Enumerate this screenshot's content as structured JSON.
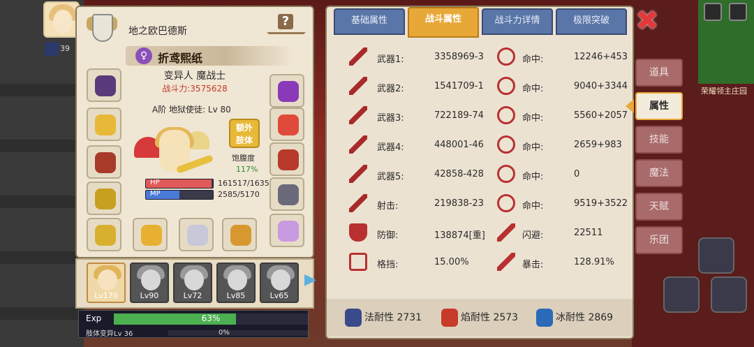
{
  "hero": {
    "realm_name": "地之欧巴德斯",
    "char_name": "折鸢熙纸",
    "class_line": "变异人 魔战士",
    "power_label": "战斗力:3575628",
    "rank_line": "A阶 地狱使徒: Lv 80",
    "extra_limb_btn": "额外\n肢体",
    "satiety_label": "饱腹度",
    "satiety_value": "117%",
    "hp_label": "HP",
    "hp_value": "161517/1635",
    "hp_fill": 0.98,
    "mp_label": "MP",
    "mp_value": "2585/5170",
    "mp_fill": 0.5,
    "hp_color": "#e05a5a",
    "mp_color": "#4a7ad8"
  },
  "top_left": {
    "level_badge": "39"
  },
  "party": [
    {
      "lv": "Lv170",
      "active": true
    },
    {
      "lv": "Lv90",
      "active": false
    },
    {
      "lv": "Lv72",
      "active": false
    },
    {
      "lv": "Lv85",
      "active": false
    },
    {
      "lv": "Lv65",
      "active": false
    }
  ],
  "exp": {
    "label": "Exp",
    "percent": "63%",
    "fill": 0.63,
    "limb_label": "肢体变异Lv 36",
    "limb_percent": "0%",
    "limb_fill": 0.0
  },
  "tabs": [
    {
      "label": "基础属性",
      "active": false
    },
    {
      "label": "战斗属性",
      "active": true
    },
    {
      "label": "战斗力详情",
      "active": false
    },
    {
      "label": "极限突破",
      "active": false
    }
  ],
  "stats": [
    {
      "label": "武器1:",
      "value": "3358969-3",
      "label2": "命中:",
      "value2": "12246+453"
    },
    {
      "label": "武器2:",
      "value": "1541709-1",
      "label2": "命中:",
      "value2": "9040+3344"
    },
    {
      "label": "武器3:",
      "value": "722189-74",
      "label2": "命中:",
      "value2": "5560+2057"
    },
    {
      "label": "武器4:",
      "value": "448001-46",
      "label2": "命中:",
      "value2": "2659+983"
    },
    {
      "label": "武器5:",
      "value": "42858-428",
      "label2": "命中:",
      "value2": "0"
    },
    {
      "label": "射击:",
      "value": "219838-23",
      "label2": "命中:",
      "value2": "9519+3522"
    },
    {
      "label": "防御:",
      "value": "138874[重]",
      "label2": "闪避:",
      "value2": "22511"
    },
    {
      "label": "格挡:",
      "value": "15.00%",
      "label2": "暴击:",
      "value2": "128.91%"
    }
  ],
  "resistances": [
    {
      "label": "法耐性 2731",
      "color": "#3a4a8a"
    },
    {
      "label": "焰耐性 2573",
      "color": "#c83a2a"
    },
    {
      "label": "冰耐性 2869",
      "color": "#2a6ab8"
    }
  ],
  "side_menu": [
    {
      "label": "道具",
      "active": false
    },
    {
      "label": "属性",
      "active": true
    },
    {
      "label": "技能",
      "active": false
    },
    {
      "label": "魔法",
      "active": false
    },
    {
      "label": "天赋",
      "active": false
    },
    {
      "label": "乐团",
      "active": false
    }
  ],
  "close_label": "✖",
  "right_bg_label": "荣耀领主庄园"
}
